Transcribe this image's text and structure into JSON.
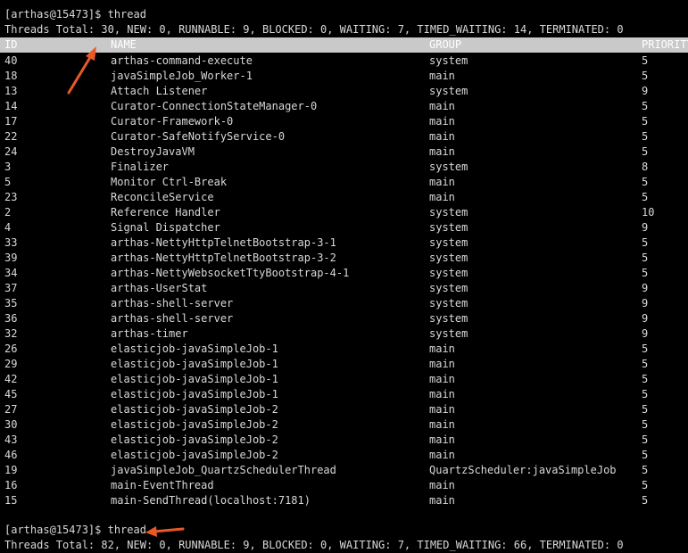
{
  "terminal": {
    "prompt1": "[arthas@15473]$ thread",
    "summary1": "Threads Total: 30, NEW: 0, RUNNABLE: 9, BLOCKED: 0, WAITING: 7, TIMED_WAITING: 14, TERMINATED: 0",
    "prompt2": "[arthas@15473]$ thread",
    "summary2": "Threads Total: 82, NEW: 0, RUNNABLE: 9, BLOCKED: 0, WAITING: 7, TIMED_WAITING: 66, TERMINATED: 0"
  },
  "table": {
    "columns": [
      "ID",
      "NAME",
      "GROUP",
      "PRIORITY"
    ],
    "rows": [
      {
        "id": "40",
        "name": "arthas-command-execute",
        "group": "system",
        "priority": "5"
      },
      {
        "id": "18",
        "name": "javaSimpleJob_Worker-1",
        "group": "main",
        "priority": "5"
      },
      {
        "id": "13",
        "name": "Attach Listener",
        "group": "system",
        "priority": "9"
      },
      {
        "id": "14",
        "name": "Curator-ConnectionStateManager-0",
        "group": "main",
        "priority": "5"
      },
      {
        "id": "17",
        "name": "Curator-Framework-0",
        "group": "main",
        "priority": "5"
      },
      {
        "id": "22",
        "name": "Curator-SafeNotifyService-0",
        "group": "main",
        "priority": "5"
      },
      {
        "id": "24",
        "name": "DestroyJavaVM",
        "group": "main",
        "priority": "5"
      },
      {
        "id": "3",
        "name": "Finalizer",
        "group": "system",
        "priority": "8"
      },
      {
        "id": "5",
        "name": "Monitor Ctrl-Break",
        "group": "main",
        "priority": "5"
      },
      {
        "id": "23",
        "name": "ReconcileService",
        "group": "main",
        "priority": "5"
      },
      {
        "id": "2",
        "name": "Reference Handler",
        "group": "system",
        "priority": "10"
      },
      {
        "id": "4",
        "name": "Signal Dispatcher",
        "group": "system",
        "priority": "9"
      },
      {
        "id": "33",
        "name": "arthas-NettyHttpTelnetBootstrap-3-1",
        "group": "system",
        "priority": "5"
      },
      {
        "id": "39",
        "name": "arthas-NettyHttpTelnetBootstrap-3-2",
        "group": "system",
        "priority": "5"
      },
      {
        "id": "34",
        "name": "arthas-NettyWebsocketTtyBootstrap-4-1",
        "group": "system",
        "priority": "5"
      },
      {
        "id": "37",
        "name": "arthas-UserStat",
        "group": "system",
        "priority": "9"
      },
      {
        "id": "35",
        "name": "arthas-shell-server",
        "group": "system",
        "priority": "9"
      },
      {
        "id": "36",
        "name": "arthas-shell-server",
        "group": "system",
        "priority": "9"
      },
      {
        "id": "32",
        "name": "arthas-timer",
        "group": "system",
        "priority": "9"
      },
      {
        "id": "26",
        "name": "elasticjob-javaSimpleJob-1",
        "group": "main",
        "priority": "5"
      },
      {
        "id": "29",
        "name": "elasticjob-javaSimpleJob-1",
        "group": "main",
        "priority": "5"
      },
      {
        "id": "42",
        "name": "elasticjob-javaSimpleJob-1",
        "group": "main",
        "priority": "5"
      },
      {
        "id": "45",
        "name": "elasticjob-javaSimpleJob-1",
        "group": "main",
        "priority": "5"
      },
      {
        "id": "27",
        "name": "elasticjob-javaSimpleJob-2",
        "group": "main",
        "priority": "5"
      },
      {
        "id": "30",
        "name": "elasticjob-javaSimpleJob-2",
        "group": "main",
        "priority": "5"
      },
      {
        "id": "43",
        "name": "elasticjob-javaSimpleJob-2",
        "group": "main",
        "priority": "5"
      },
      {
        "id": "46",
        "name": "elasticjob-javaSimpleJob-2",
        "group": "main",
        "priority": "5"
      },
      {
        "id": "19",
        "name": "javaSimpleJob_QuartzSchedulerThread",
        "group": "QuartzScheduler:javaSimpleJob",
        "priority": "5"
      },
      {
        "id": "16",
        "name": "main-EventThread",
        "group": "main",
        "priority": "5"
      },
      {
        "id": "15",
        "name": "main-SendThread(localhost:7181)",
        "group": "main",
        "priority": "5"
      }
    ]
  },
  "colors": {
    "background": "#000000",
    "text": "#d8d8d8",
    "header_background": "#c9c9c9",
    "header_text": "#ffffff",
    "annotation_arrow": "#e8592a"
  },
  "annotations": [
    {
      "icon": "arrow-annotation-icon",
      "points_to": "summary1.total"
    },
    {
      "icon": "arrow-annotation-icon",
      "points_to": "prompt2.command"
    }
  ]
}
